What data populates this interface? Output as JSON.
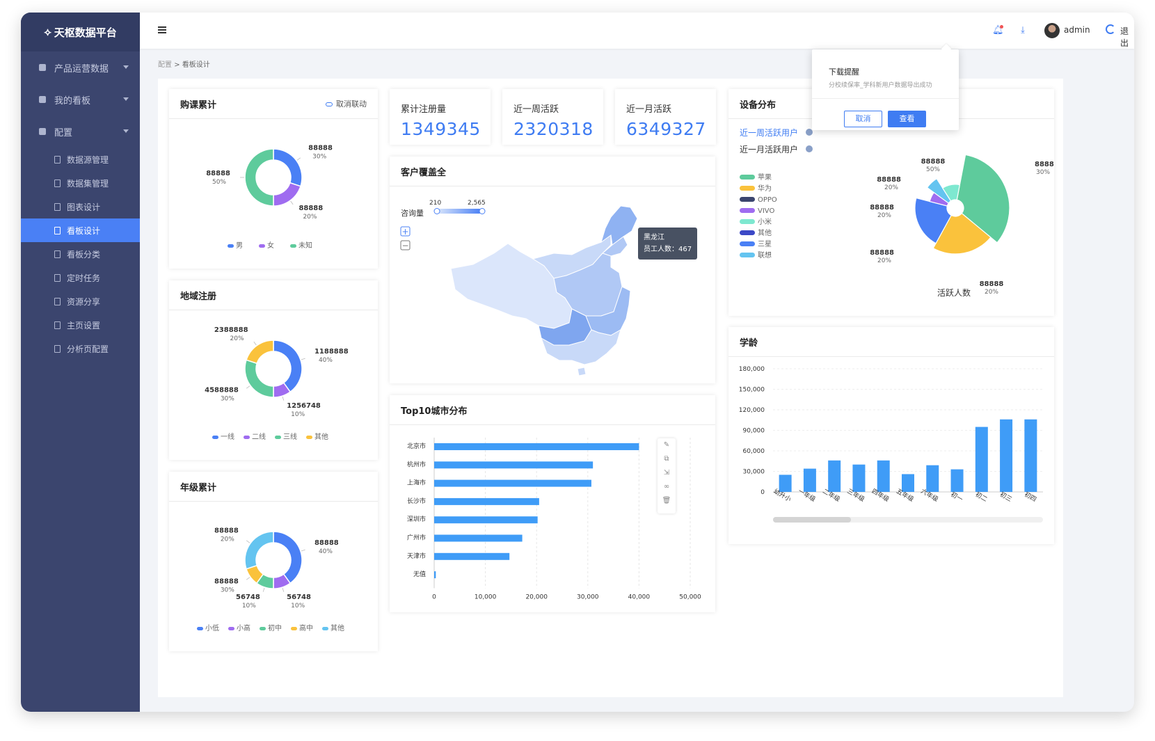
{
  "sidebar": {
    "logo": "天枢数据平台",
    "groups": [
      {
        "label": "产品运营数据"
      },
      {
        "label": "我的看板"
      },
      {
        "label": "配置"
      }
    ],
    "items": [
      {
        "label": "数据源管理"
      },
      {
        "label": "数据集管理"
      },
      {
        "label": "图表设计"
      },
      {
        "label": "看板设计"
      },
      {
        "label": "看板分类"
      },
      {
        "label": "定时任务"
      },
      {
        "label": "资源分享"
      },
      {
        "label": "主页设置"
      },
      {
        "label": "分析页配置"
      }
    ]
  },
  "topbar": {
    "user": "admin",
    "logout": "退出"
  },
  "breadcrumb": {
    "root": "配置",
    "sep": ">",
    "current": "看板设计"
  },
  "popup": {
    "title": "下载提醒",
    "message": "分校续保率_学科新用户数据导出成功",
    "cancel": "取消",
    "confirm": "查看"
  },
  "stats": [
    {
      "label": "累计注册量",
      "value": "1349345"
    },
    {
      "label": "近一周活跃",
      "value": "2320318"
    },
    {
      "label": "近一月活跃",
      "value": "6349327"
    }
  ],
  "cards": {
    "course": {
      "title": "购课累计",
      "action": "取消联动"
    },
    "region": {
      "title": "地域注册"
    },
    "grade": {
      "title": "年级累计"
    },
    "coverage": {
      "title": "客户覆盖全"
    },
    "top10": {
      "title": "Top10城市分布"
    },
    "device": {
      "title": "设备分布"
    },
    "age": {
      "title": "学龄"
    }
  },
  "map": {
    "visual_label": "咨询量",
    "min": "210",
    "max": "2,565",
    "tooltip_title": "黑龙江",
    "tooltip_text": "员工人数：467",
    "zoom_in": "+",
    "zoom_out": "−"
  },
  "device_filters": [
    {
      "label": "近一周活跃用户",
      "active": true
    },
    {
      "label": "近一月活跃用户",
      "active": false
    }
  ],
  "chart_data": [
    {
      "type": "pie",
      "title": "购课累计",
      "categories": [
        "男",
        "女",
        "未知"
      ],
      "values": [
        30,
        20,
        50
      ],
      "labels": [
        {
          "value": "88888",
          "pct": "30%"
        },
        {
          "value": "88888",
          "pct": "20%"
        },
        {
          "value": "88888",
          "pct": "50%"
        }
      ],
      "colors": [
        "#4a80f5",
        "#9f6cf0",
        "#5ecb9c"
      ]
    },
    {
      "type": "pie",
      "title": "地域注册",
      "categories": [
        "一线",
        "二线",
        "三线",
        "其他"
      ],
      "values": [
        40,
        10,
        30,
        20
      ],
      "labels": [
        {
          "value": "1188888",
          "pct": "40%"
        },
        {
          "value": "1256748",
          "pct": "10%"
        },
        {
          "value": "4588888",
          "pct": "30%"
        },
        {
          "value": "2388888",
          "pct": "20%"
        }
      ],
      "colors": [
        "#4a80f5",
        "#9f6cf0",
        "#5ecb9c",
        "#fac23c"
      ]
    },
    {
      "type": "pie",
      "title": "年级累计",
      "categories": [
        "小低",
        "小高",
        "初中",
        "高中",
        "其他"
      ],
      "values": [
        40,
        10,
        10,
        10,
        30
      ],
      "labels": [
        {
          "value": "88888",
          "pct": "40%"
        },
        {
          "value": "56748",
          "pct": "10%"
        },
        {
          "value": "56748",
          "pct": "10%"
        },
        {
          "value": "88888",
          "pct": "30%"
        },
        {
          "value": "88888",
          "pct": "20%"
        }
      ],
      "colors": [
        "#4a80f5",
        "#9f6cf0",
        "#5ecb9c",
        "#fac23c",
        "#64c4f0"
      ]
    },
    {
      "type": "bar",
      "title": "Top10城市分布",
      "orientation": "horizontal",
      "categories": [
        "北京市",
        "杭州市",
        "上海市",
        "长沙市",
        "深圳市",
        "广州市",
        "天津市",
        "无值"
      ],
      "values": [
        40000,
        31000,
        30700,
        20500,
        20200,
        17200,
        14700,
        320
      ],
      "xlim": [
        0,
        50000
      ],
      "xticks": [
        "0",
        "10,000",
        "20,000",
        "30,000",
        "40,000",
        "50,000"
      ],
      "color": "#3f9cf7"
    },
    {
      "type": "pie",
      "title": "设备分布",
      "subtitle": "活跃人数",
      "categories": [
        "苹果",
        "华为",
        "OPPO",
        "VIVO",
        "小米",
        "其他",
        "三星",
        "联想"
      ],
      "values": [
        30,
        20,
        20,
        20,
        50,
        10,
        10,
        5
      ],
      "labels": [
        {
          "value": "88888",
          "pct": "30%"
        },
        {
          "value": "88888",
          "pct": "20%"
        },
        {
          "value": "88888",
          "pct": "20%"
        },
        {
          "value": "88888",
          "pct": "20%"
        },
        {
          "value": "88888",
          "pct": "20%"
        },
        {
          "value": "88888",
          "pct": "50%"
        }
      ],
      "colors": [
        "#5ecb9c",
        "#fac23c",
        "#3b456e",
        "#9f6cf0",
        "#7ee8d0",
        "#3b48c6",
        "#4a80f5",
        "#64c4f0"
      ]
    },
    {
      "type": "bar",
      "title": "学龄",
      "categories": [
        "幼升小",
        "一年级",
        "二年级",
        "三年级",
        "四年级",
        "五年级",
        "六年级",
        "初一",
        "初二",
        "初三",
        "初四"
      ],
      "values": [
        25000,
        34000,
        46000,
        40000,
        46000,
        26000,
        39000,
        33000,
        95000,
        106000,
        106000
      ],
      "ylim": [
        0,
        180000
      ],
      "yticks": [
        "180,000",
        "150,000",
        "120,000",
        "90,000",
        "60,000",
        "30,000",
        "0"
      ],
      "color": "#3f9cf7"
    }
  ]
}
